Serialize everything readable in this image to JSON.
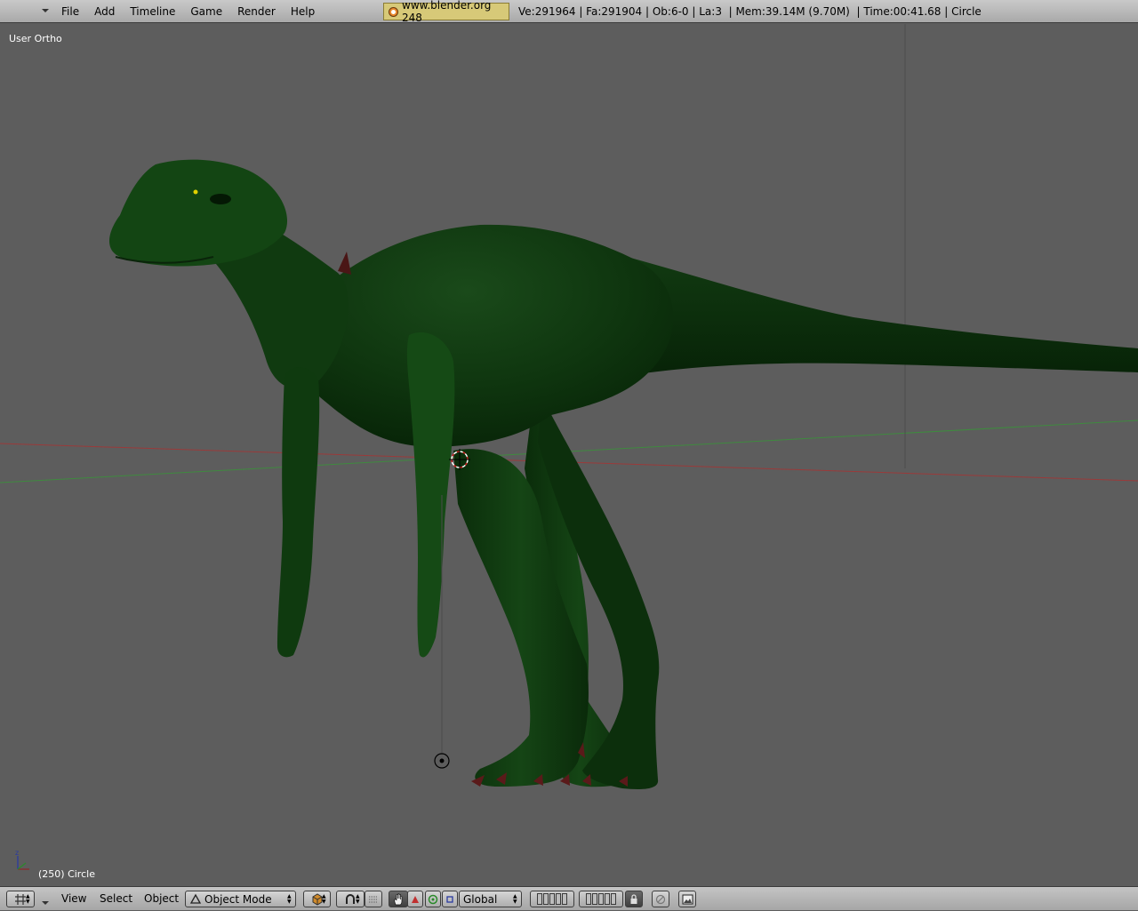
{
  "header": {
    "menu": [
      "File",
      "Add",
      "Timeline",
      "Game",
      "Render",
      "Help"
    ],
    "logo_text": "www.blender.org 248",
    "stats": "Ve:291964 | Fa:291904 | Ob:6-0 | La:3  | Mem:39.14M (9.70M)  | Time:00:41.68 | Circle"
  },
  "viewport": {
    "view_label": "User Ortho",
    "object_label": "(250) Circle",
    "model_color": "#0f3a0f",
    "x_axis_color": "#9a3a3a",
    "y_axis_color": "#3f8a3f"
  },
  "footer": {
    "menu": [
      "View",
      "Select",
      "Object"
    ],
    "mode": "Object Mode",
    "orientation": "Global"
  },
  "icons": {
    "window_type": "view3d-grid-icon",
    "collapse": "chevron-down-icon",
    "draw_type": "solid-cube-icon",
    "pivot": "magnet-pivot-icon",
    "manipulator": "hand-icon",
    "translate": "triangle-icon",
    "rotate": "ring-icon",
    "scale": "square-icon",
    "lock": "lock-icon",
    "render": "render-icon"
  }
}
